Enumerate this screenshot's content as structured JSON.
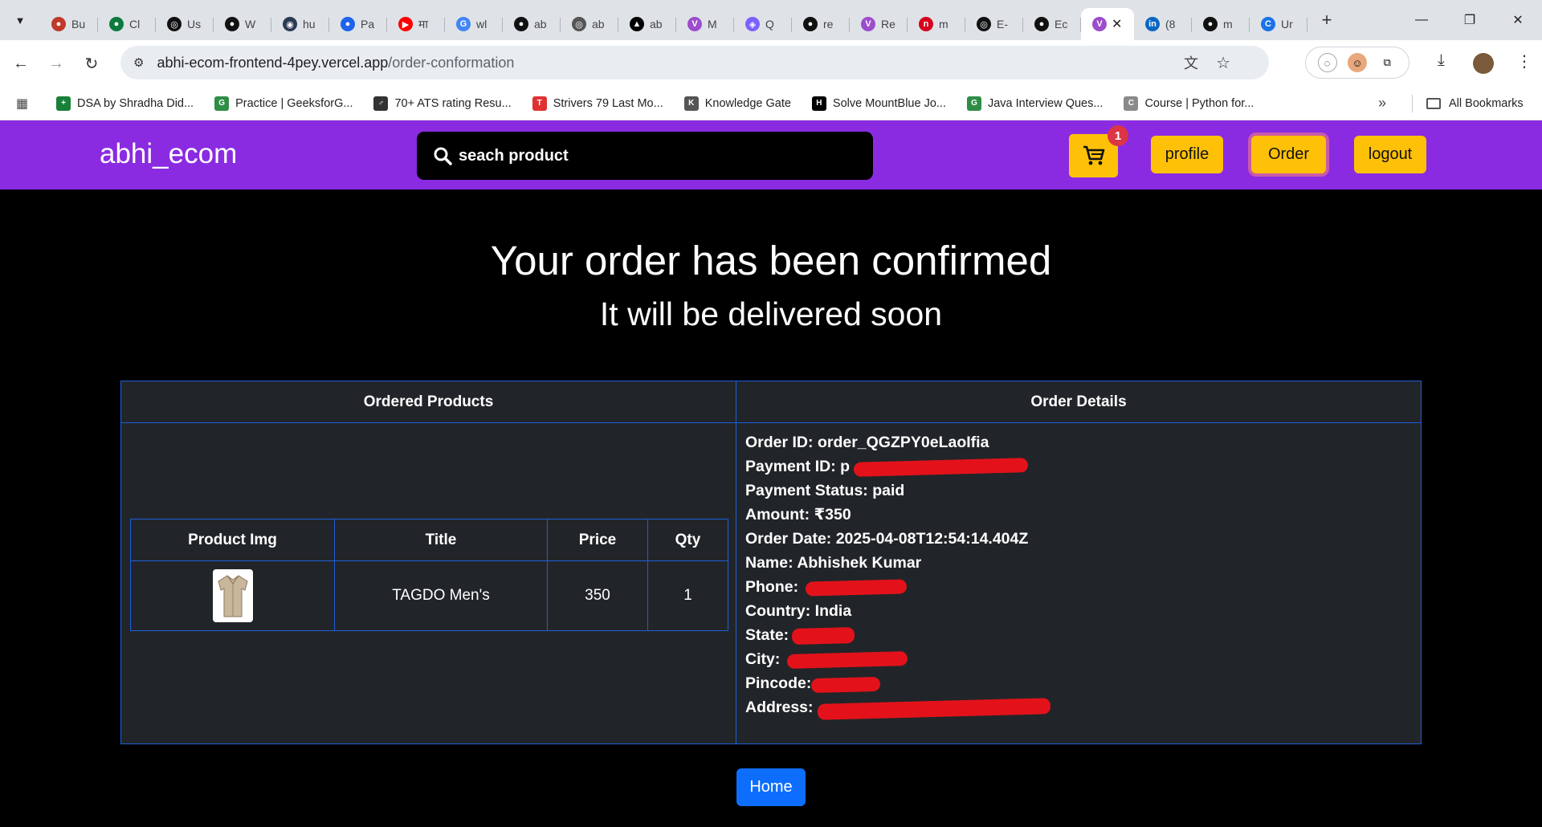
{
  "browser": {
    "tabs": [
      {
        "label": "Bu",
        "color": "#c0392b",
        "glyph": "●"
      },
      {
        "label": "Cl",
        "color": "#0c7a3e",
        "glyph": "●"
      },
      {
        "label": "Us",
        "color": "#111111",
        "glyph": "◎"
      },
      {
        "label": "W",
        "color": "#111111",
        "glyph": "●"
      },
      {
        "label": "hu",
        "color": "#2b3a55",
        "glyph": "◉"
      },
      {
        "label": "Pa",
        "color": "#1d63ed",
        "glyph": "●"
      },
      {
        "label": "मा",
        "color": "#ff0000",
        "glyph": "▶"
      },
      {
        "label": "wl",
        "color": "#4285f4",
        "glyph": "G"
      },
      {
        "label": "ab",
        "color": "#111111",
        "glyph": "●"
      },
      {
        "label": "ab",
        "color": "#555555",
        "glyph": "◎"
      },
      {
        "label": "ab",
        "color": "#000000",
        "glyph": "▲"
      },
      {
        "label": "M",
        "color": "#9c4dcc",
        "glyph": "V"
      },
      {
        "label": "Q",
        "color": "#7b61ff",
        "glyph": "◈"
      },
      {
        "label": "re",
        "color": "#111111",
        "glyph": "●"
      },
      {
        "label": "Re",
        "color": "#9c4dcc",
        "glyph": "V"
      },
      {
        "label": "m",
        "color": "#d6001c",
        "glyph": "n"
      },
      {
        "label": "E-",
        "color": "#111111",
        "glyph": "◎"
      },
      {
        "label": "Ec",
        "color": "#111111",
        "glyph": "●"
      }
    ],
    "active_tab": {
      "color": "#9c4dcc",
      "glyph": "V"
    },
    "tabs_after": [
      {
        "label": "(8",
        "color": "#0a66c2",
        "glyph": "in"
      },
      {
        "label": "m",
        "color": "#111111",
        "glyph": "●"
      },
      {
        "label": "Ur",
        "color": "#1a73e8",
        "glyph": "C"
      }
    ],
    "url_host": "abhi-ecom-frontend-4pey.vercel.app",
    "url_path": "/order-conformation",
    "bookmarks": [
      {
        "label": "DSA by Shradha Did...",
        "color": "#188038",
        "glyph": "+"
      },
      {
        "label": "Practice | GeeksforG...",
        "color": "#2f8d46",
        "glyph": "G"
      },
      {
        "label": "70+ ATS rating Resu...",
        "color": "#333333",
        "glyph": "♂"
      },
      {
        "label": "Strivers 79 Last Mo...",
        "color": "#e03131",
        "glyph": "T"
      },
      {
        "label": "Knowledge Gate",
        "color": "#555555",
        "glyph": "K"
      },
      {
        "label": "Solve MountBlue Jo...",
        "color": "#000000",
        "glyph": "H"
      },
      {
        "label": "Java Interview Ques...",
        "color": "#2f8d46",
        "glyph": "G"
      },
      {
        "label": "Course | Python for...",
        "color": "#8a8a8a",
        "glyph": "C"
      }
    ],
    "all_bookmarks": "All Bookmarks"
  },
  "site": {
    "brand": "abhi_ecom",
    "search_placeholder": "seach product",
    "cart_count": "1",
    "nav": {
      "profile": "profile",
      "order": "Order",
      "logout": "logout"
    },
    "accent": "#8a2be2",
    "button_color": "#ffc107"
  },
  "page": {
    "heading": "Your order has been confirmed",
    "subheading": "It will be delivered soon",
    "ordered_products_header": "Ordered Products",
    "order_details_header": "Order Details",
    "product_table": {
      "columns": [
        "Product Img",
        "Title",
        "Price",
        "Qty"
      ],
      "rows": [
        {
          "title": "TAGDO Men's",
          "price": "350",
          "qty": "1"
        }
      ]
    },
    "order_details": {
      "order_id_label": "Order ID:",
      "order_id": "order_QGZPY0eLaoIfia",
      "payment_id_label": "Payment ID:",
      "payment_id": "p",
      "payment_status_label": "Payment Status:",
      "payment_status": "paid",
      "amount_label": "Amount:",
      "amount": "₹350",
      "order_date_label": "Order Date:",
      "order_date": "2025-04-08T12:54:14.404Z",
      "name_label": "Name:",
      "name": "Abhishek Kumar",
      "phone_label": "Phone:",
      "phone": "",
      "country_label": "Country:",
      "country": "India",
      "state_label": "State:",
      "state": "",
      "city_label": "City:",
      "city": "",
      "pincode_label": "Pincode:",
      "pincode": "",
      "address_label": "Address:",
      "address": ""
    },
    "home_button": "Home"
  }
}
